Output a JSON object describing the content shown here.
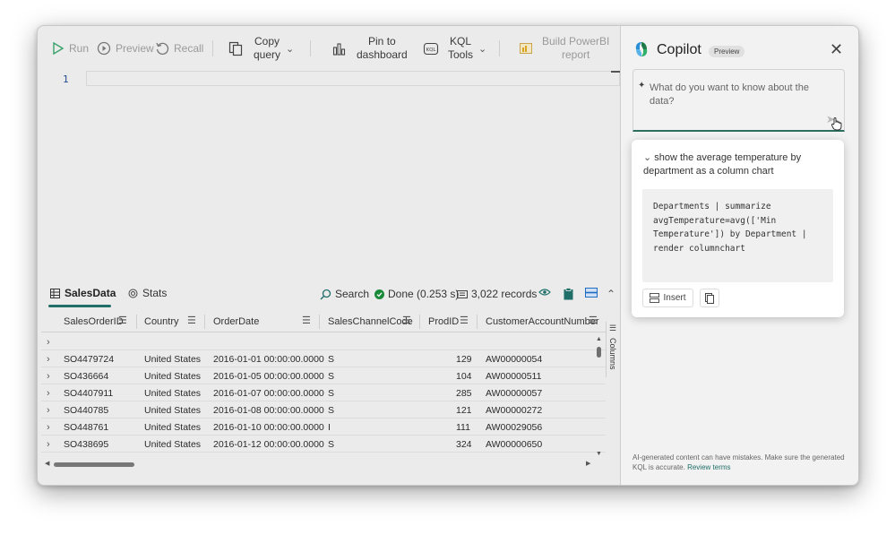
{
  "toolbar": {
    "run": "Run",
    "preview": "Preview",
    "recall": "Recall",
    "copy_query_1": "Copy",
    "copy_query_2": "query",
    "pin_1": "Pin to",
    "pin_2": "dashboard",
    "kql_1": "KQL",
    "kql_2": "Tools",
    "powerbi_1": "Build PowerBI",
    "powerbi_2": "report"
  },
  "editor": {
    "line_number": "1"
  },
  "results": {
    "tab_salesdata": "SalesData",
    "tab_stats": "Stats",
    "search": "Search",
    "status": "Done (0.253 s)",
    "records": "3,022 records",
    "columns_label": "Columns",
    "headers": [
      "SalesOrderID",
      "Country",
      "OrderDate",
      "SalesChannelCode",
      "ProdID",
      "CustomerAccountNumber"
    ],
    "rows": [
      [
        "SO4479724",
        "United States",
        "2016-01-01 00:00:00.0000",
        "S",
        "129",
        "AW00000054"
      ],
      [
        "SO436664",
        "United States",
        "2016-01-05 00:00:00.0000",
        "S",
        "104",
        "AW00000511"
      ],
      [
        "SO4407911",
        "United States",
        "2016-01-07 00:00:00.0000",
        "S",
        "285",
        "AW00000057"
      ],
      [
        "SO440785",
        "United States",
        "2016-01-08 00:00:00.0000",
        "S",
        "121",
        "AW00000272"
      ],
      [
        "SO448761",
        "United States",
        "2016-01-10 00:00:00.0000",
        "I",
        "111",
        "AW00029056"
      ],
      [
        "SO438695",
        "United States",
        "2016-01-12 00:00:00.0000",
        "S",
        "324",
        "AW00000650"
      ]
    ]
  },
  "copilot": {
    "title": "Copilot",
    "badge": "Preview",
    "ask_placeholder": "What do you want to know about the data?",
    "suggestion_prompt": "show the average temperature by department as a column chart",
    "suggestion_code": "Departments | summarize\navgTemperature=avg(['Min\nTemperature']) by Department |\nrender columnchart",
    "insert_label": "Insert",
    "disclaimer": "AI-generated content can have mistakes. Make sure the generated KQL is accurate.",
    "disclaimer_link": "Review terms"
  },
  "colors": {
    "accent": "#1f6e68",
    "status_green": "#1a8a3a",
    "icon_blue": "#1f6bc4"
  }
}
